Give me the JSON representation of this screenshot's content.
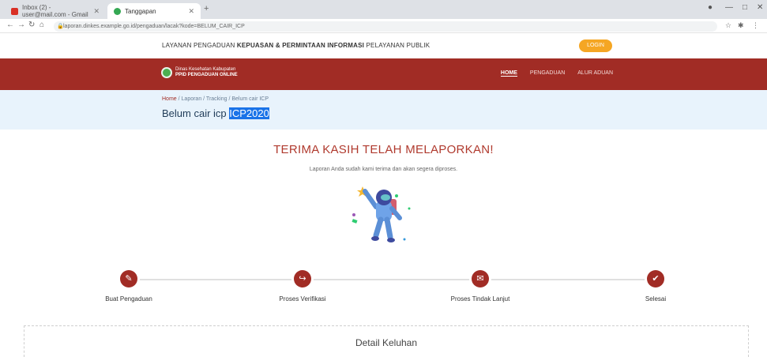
{
  "browser": {
    "tabs": [
      {
        "title": "Inbox (2) - user@mail.com - Gmail"
      },
      {
        "title": "Tanggapan"
      }
    ],
    "url": "laporan.dinkes.example.go.id/pengaduan/lacak?kode=BELUM_CAIR_ICP",
    "new_tab": "+"
  },
  "infobar": {
    "text_before": "LAYANAN PENGADUAN",
    "text_bold": "KEPUASAN & PERMINTAAN INFORMASI",
    "text_after": "PELAYANAN PUBLIK",
    "button": "LOGIN"
  },
  "navbar": {
    "logo_line1": "Dinas Kesehatan Kabupaten",
    "logo_line2": "PPID PENGADUAN ONLINE",
    "menu": [
      "HOME",
      "PENGADUAN",
      "ALUR ADUAN"
    ]
  },
  "breadcrumb": {
    "home": "Home",
    "path": "/ Laporan / Tracking / Belum cair ICP"
  },
  "page_title": {
    "main": "Belum cair icp ",
    "selected": "ICP2020"
  },
  "thanks_title": "TERIMA KASIH TELAH MELAPORKAN!",
  "thanks_subtitle": "Laporan Anda sudah kami terima dan akan segera diproses.",
  "steps": [
    {
      "label": "Buat Pengaduan",
      "icon": "pencil-icon",
      "glyph": "✎"
    },
    {
      "label": "Proses Verifikasi",
      "icon": "share-icon",
      "glyph": "↪"
    },
    {
      "label": "Proses Tindak Lanjut",
      "icon": "chat-icon",
      "glyph": "✉"
    },
    {
      "label": "Selesai",
      "icon": "check-icon",
      "glyph": "✔"
    }
  ],
  "detail_title": "Detail Keluhan",
  "colors": {
    "brand_red": "#a12c25",
    "band_blue": "#e8f3fc",
    "accent_orange": "#f5a623"
  }
}
